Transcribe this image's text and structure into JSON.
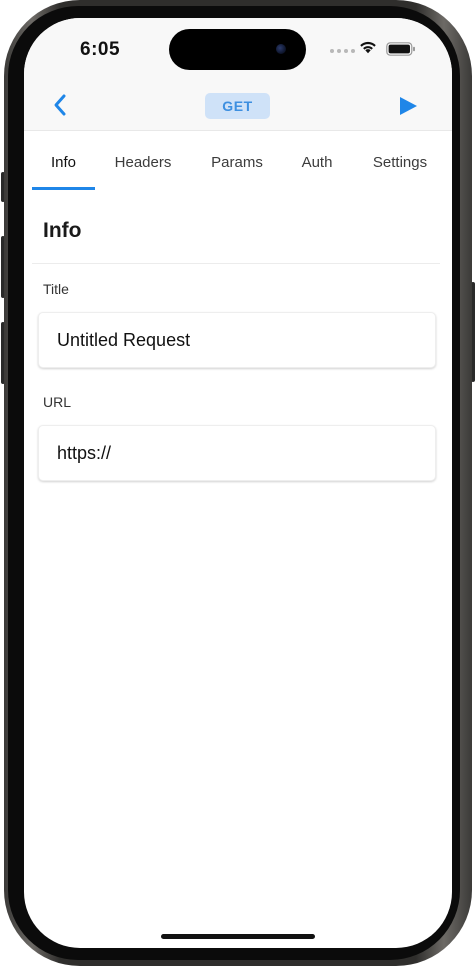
{
  "status_bar": {
    "time": "6:05"
  },
  "nav": {
    "method": "GET",
    "back_icon": "chevron-left-icon",
    "run_icon": "play-icon"
  },
  "tabs": [
    {
      "label": "Info",
      "active": true
    },
    {
      "label": "Headers",
      "active": false
    },
    {
      "label": "Params",
      "active": false
    },
    {
      "label": "Auth",
      "active": false
    },
    {
      "label": "Settings",
      "active": false
    }
  ],
  "info": {
    "section_title": "Info",
    "title_label": "Title",
    "title_value": "Untitled Request",
    "url_label": "URL",
    "url_value": "https://"
  },
  "colors": {
    "accent": "#1f86e8",
    "badge_bg": "#cfe2f8",
    "badge_text": "#3d8fe0",
    "bar_bg": "#f8f8f8"
  }
}
